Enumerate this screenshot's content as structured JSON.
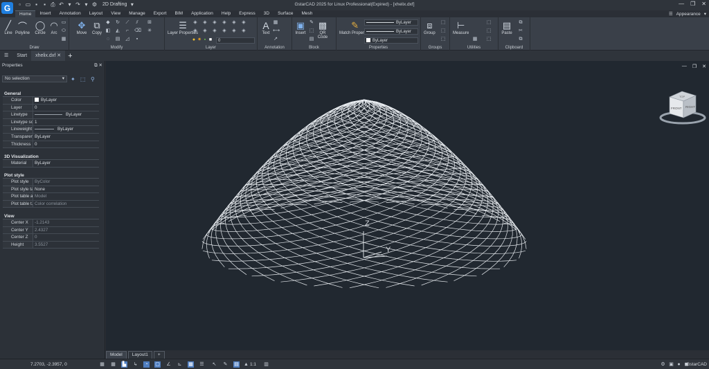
{
  "titlebar": {
    "logo": "G",
    "workspace": "2D Drafting",
    "title": "GstarCAD 2025 for Linux Professional(Expired) - [xhelix.dxf]",
    "min_icon": "minimize-icon",
    "restore_icon": "restore-icon",
    "close_icon": "close-icon"
  },
  "tabs": [
    "Home",
    "Insert",
    "Annotation",
    "Layout",
    "View",
    "Manage",
    "Export",
    "BIM",
    "Application",
    "Help",
    "Express",
    "3D",
    "Surface",
    "Mesh"
  ],
  "appearance": "Appearance",
  "ribbon": {
    "draw": {
      "title": "Draw",
      "line": "Line",
      "polyline": "Polyline",
      "circle": "Circle",
      "arc": "Arc"
    },
    "modify": {
      "title": "Modify",
      "move": "Move",
      "copy": "Copy"
    },
    "layer": {
      "title": "Layer",
      "layer_properties": "Layer Properties",
      "layer_value": "0"
    },
    "annotation": {
      "title": "Annotation",
      "text": "Text"
    },
    "block": {
      "title": "Block",
      "insert": "Insert",
      "qr_code": "QR Code"
    },
    "properties": {
      "title": "Properties",
      "match": "Match Properties",
      "linetype": "ByLayer",
      "lineweight": "ByLayer",
      "color": "ByLayer"
    },
    "groups": {
      "title": "Groups",
      "group": "Group"
    },
    "utilities": {
      "title": "Utilities",
      "measure": "Measure"
    },
    "clipboard": {
      "title": "Clipboard",
      "paste": "Paste"
    }
  },
  "doctabs": {
    "start": "Start",
    "file": "xhelix.dxf"
  },
  "properties": {
    "title": "Properties",
    "selection": "No selection",
    "general": {
      "title": "General",
      "rows": [
        {
          "k": "Color",
          "v": "ByLayer"
        },
        {
          "k": "Layer",
          "v": "0"
        },
        {
          "k": "Linetype",
          "v": "ByLayer"
        },
        {
          "k": "Linetype sc...",
          "v": "1"
        },
        {
          "k": "Lineweight",
          "v": "ByLayer"
        },
        {
          "k": "Transparency",
          "v": "ByLayer"
        },
        {
          "k": "Thickness",
          "v": "0"
        }
      ]
    },
    "viz": {
      "title": "3D Visualization",
      "rows": [
        {
          "k": "Material",
          "v": "ByLayer"
        }
      ]
    },
    "plot": {
      "title": "Plot style",
      "rows": [
        {
          "k": "Plot style",
          "v": "ByColor"
        },
        {
          "k": "Plot style ta...",
          "v": "None"
        },
        {
          "k": "Plot table a...",
          "v": "Model"
        },
        {
          "k": "Plot table t...",
          "v": "Color correlation"
        }
      ]
    },
    "view": {
      "title": "View",
      "rows": [
        {
          "k": "Center X",
          "v": "-1.2143"
        },
        {
          "k": "Center Y",
          "v": "2.4327"
        },
        {
          "k": "Center Z",
          "v": "0"
        },
        {
          "k": "Height",
          "v": "3.5527"
        }
      ]
    }
  },
  "viewcube": {
    "front": "FRONT",
    "right": "RIGHT",
    "top": "TOP"
  },
  "ucs": {
    "z": "Z",
    "y": "Y"
  },
  "layouts": {
    "model": "Model",
    "layout1": "Layout1",
    "add": "+"
  },
  "status": {
    "coords": "7.2703, -2.3957, 0",
    "scale": "1:1",
    "brand": "GstarCAD"
  },
  "colors": {
    "viewport_bg": "#212830",
    "accent": "#1f7fe0",
    "wire": "#e8ecf0"
  }
}
